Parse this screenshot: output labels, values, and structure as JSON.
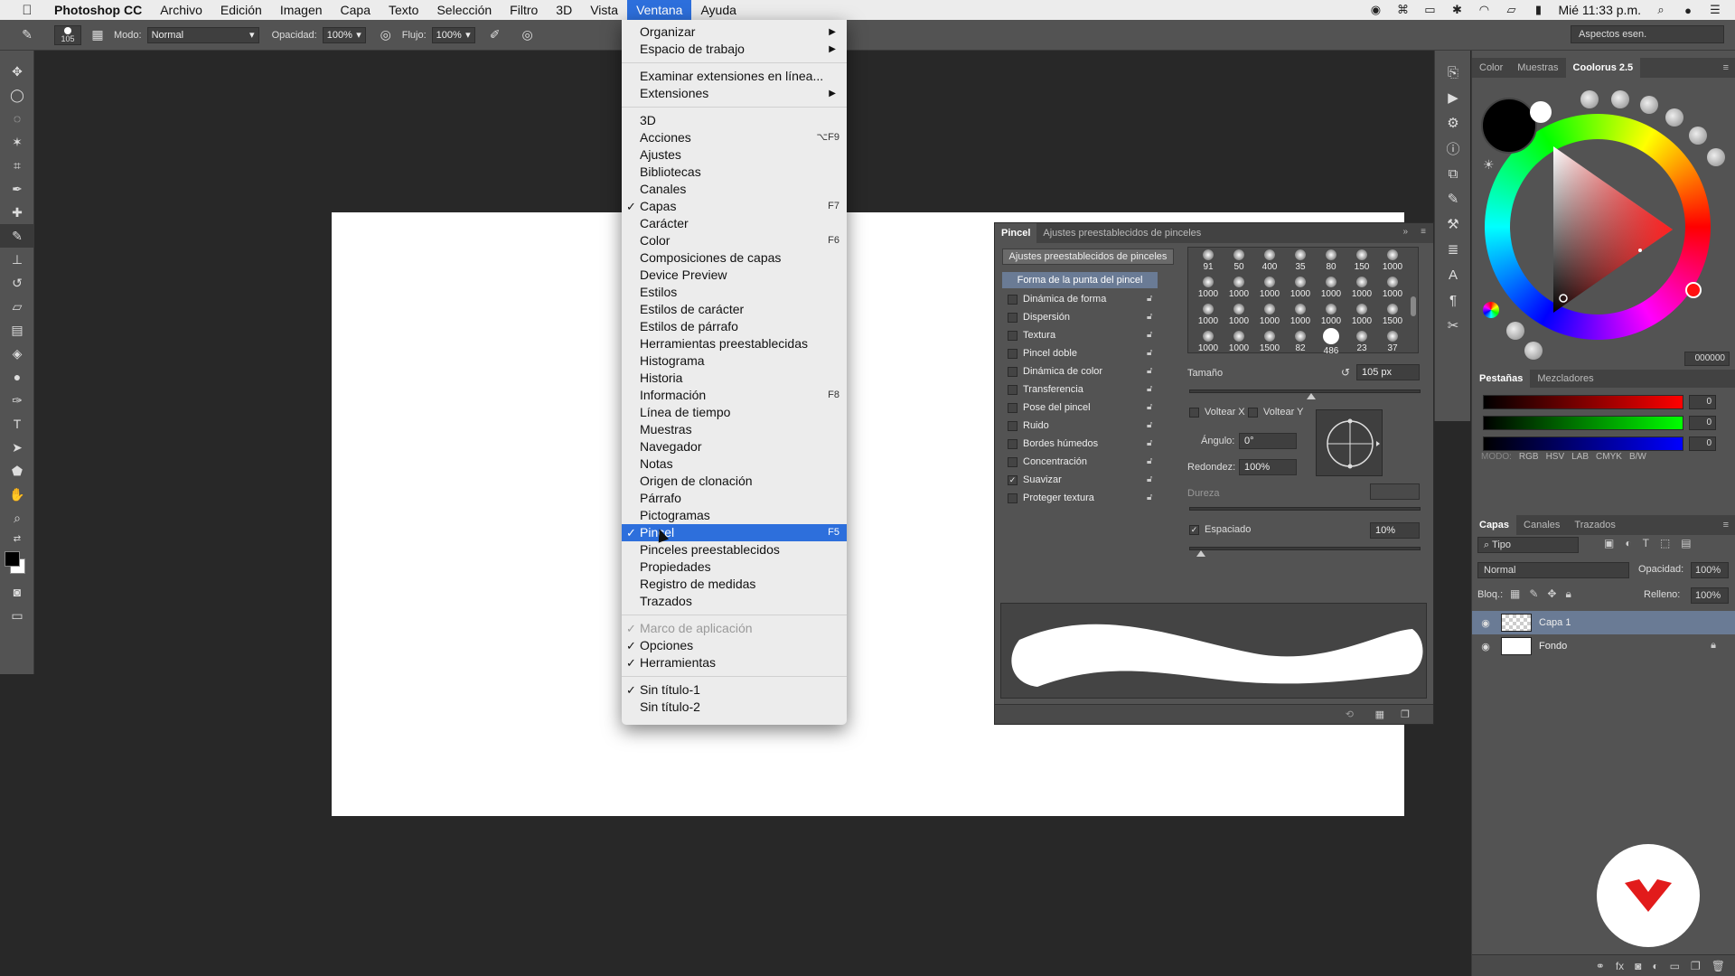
{
  "menubar": {
    "app_name": "Photoshop CC",
    "items": [
      "Archivo",
      "Edición",
      "Imagen",
      "Capa",
      "Texto",
      "Selección",
      "Filtro",
      "3D",
      "Vista",
      "Ventana",
      "Ayuda"
    ],
    "active_item": "Ventana",
    "clock": "Mié 11:33 p.m."
  },
  "options_bar": {
    "brush_size": "105",
    "mode_label": "Modo:",
    "mode_value": "Normal",
    "opacity_label": "Opacidad:",
    "opacity_value": "100%",
    "flow_label": "Flujo:",
    "flow_value": "100%",
    "workspace": "Aspectos esen."
  },
  "window_menu": {
    "items": [
      {
        "label": "Organizar",
        "submenu": true
      },
      {
        "label": "Espacio de trabajo",
        "submenu": true
      },
      {
        "sep": true
      },
      {
        "label": "Examinar extensiones en línea..."
      },
      {
        "label": "Extensiones",
        "submenu": true
      },
      {
        "sep": true
      },
      {
        "label": "3D"
      },
      {
        "label": "Acciones",
        "shortcut": "⌥F9"
      },
      {
        "label": "Ajustes"
      },
      {
        "label": "Bibliotecas"
      },
      {
        "label": "Canales"
      },
      {
        "label": "Capas",
        "checked": true,
        "shortcut": "F7"
      },
      {
        "label": "Carácter"
      },
      {
        "label": "Color",
        "shortcut": "F6"
      },
      {
        "label": "Composiciones de capas"
      },
      {
        "label": "Device Preview"
      },
      {
        "label": "Estilos"
      },
      {
        "label": "Estilos de carácter"
      },
      {
        "label": "Estilos de párrafo"
      },
      {
        "label": "Herramientas preestablecidas"
      },
      {
        "label": "Histograma"
      },
      {
        "label": "Historia"
      },
      {
        "label": "Información",
        "shortcut": "F8"
      },
      {
        "label": "Línea de tiempo"
      },
      {
        "label": "Muestras"
      },
      {
        "label": "Navegador"
      },
      {
        "label": "Notas"
      },
      {
        "label": "Origen de clonación"
      },
      {
        "label": "Párrafo"
      },
      {
        "label": "Pictogramas"
      },
      {
        "label": "Pincel",
        "checked": true,
        "shortcut": "F5",
        "highlighted": true
      },
      {
        "label": "Pinceles preestablecidos"
      },
      {
        "label": "Propiedades"
      },
      {
        "label": "Registro de medidas"
      },
      {
        "label": "Trazados"
      },
      {
        "sep": true
      },
      {
        "label": "Marco de aplicación",
        "checked": true,
        "disabled": true
      },
      {
        "label": "Opciones",
        "checked": true
      },
      {
        "label": "Herramientas",
        "checked": true
      },
      {
        "sep": true
      },
      {
        "label": "Sin título-1",
        "checked": true
      },
      {
        "label": "Sin título-2"
      }
    ]
  },
  "brush_panel": {
    "tabs": [
      "Pincel",
      "Ajustes preestablecidos de pinceles"
    ],
    "active_tab": "Pincel",
    "preset_button": "Ajustes preestablecidos de pinceles",
    "tip_shape_header": "Forma de la punta del pincel",
    "options": [
      {
        "label": "Dinámica de forma",
        "checked": false
      },
      {
        "label": "Dispersión",
        "checked": false
      },
      {
        "label": "Textura",
        "checked": false
      },
      {
        "label": "Pincel doble",
        "checked": false
      },
      {
        "label": "Dinámica de color",
        "checked": false
      },
      {
        "label": "Transferencia",
        "checked": false
      },
      {
        "label": "Pose del pincel",
        "checked": false
      },
      {
        "label": "Ruido",
        "checked": false
      },
      {
        "label": "Bordes húmedos",
        "checked": false
      },
      {
        "label": "Concentración",
        "checked": false
      },
      {
        "label": "Suavizar",
        "checked": true
      },
      {
        "label": "Proteger textura",
        "checked": false
      }
    ],
    "tip_sizes": [
      [
        "91",
        "50",
        "400",
        "35",
        "80",
        "150",
        "1000"
      ],
      [
        "1000",
        "1000",
        "1000",
        "1000",
        "1000",
        "1000",
        "1000"
      ],
      [
        "1000",
        "1000",
        "1000",
        "1000",
        "1000",
        "1000",
        "1500"
      ],
      [
        "1000",
        "1000",
        "1500",
        "82",
        "486",
        "23",
        "37"
      ]
    ],
    "size_label": "Tamaño",
    "size_value": "105 px",
    "flip_x": "Voltear X",
    "flip_y": "Voltear Y",
    "angle_label": "Ángulo:",
    "angle_value": "0°",
    "roundness_label": "Redondez:",
    "roundness_value": "100%",
    "hardness_label": "Dureza",
    "spacing_label": "Espaciado",
    "spacing_checked": true,
    "spacing_value": "10%"
  },
  "color_panel": {
    "tabs": [
      "Color",
      "Muestras",
      "Coolorus 2.5"
    ],
    "active_tab": "Coolorus 2.5",
    "hex": "000000",
    "subtabs": [
      "Pestañas",
      "Mezcladores"
    ],
    "rgb": {
      "r": "0",
      "g": "0",
      "b": "0"
    },
    "modes": [
      "MODO:",
      "RGB",
      "HSV",
      "LAB",
      "CMYK",
      "B/W"
    ]
  },
  "layers_panel": {
    "tabs": [
      "Capas",
      "Canales",
      "Trazados"
    ],
    "active_tab": "Capas",
    "filter_label": "Tipo",
    "blend_mode": "Normal",
    "opacity_label": "Opacidad:",
    "opacity_value": "100%",
    "lock_label": "Bloq.:",
    "fill_label": "Relleno:",
    "fill_value": "100%",
    "layers": [
      {
        "name": "Capa 1",
        "selected": true,
        "locked": false
      },
      {
        "name": "Fondo",
        "selected": false,
        "locked": true
      }
    ]
  },
  "colors": {
    "accent": "#2d6fdc",
    "panel": "#535353",
    "selection": "#6a7b95"
  }
}
